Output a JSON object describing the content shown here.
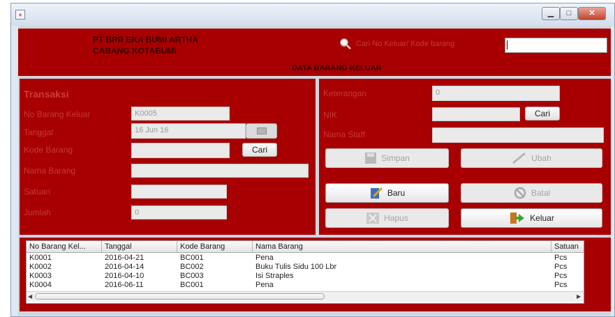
{
  "header": {
    "company_line1": "PT BPR EKA BUMI ARTHA",
    "company_line2": "CABANG KOTABUMI",
    "search_label": "Cari No Keluar/ Kode barang",
    "search_value": "",
    "title": "DATA BARANG KELUAR"
  },
  "transaksi": {
    "heading": "Transaksi",
    "no_keluar_label": "No Barang Keluar",
    "no_keluar_value": "K0005",
    "tanggal_label": "Tanggal",
    "tanggal_value": "16 Jun 16",
    "kode_label": "Kode Barang",
    "kode_value": "",
    "cari_label": "Cari",
    "nama_label": "Nama Barang",
    "nama_value": "",
    "satuan_label": "Satuan",
    "satuan_value": "",
    "jumlah_label": "Jumlah",
    "jumlah_value": "0"
  },
  "right": {
    "keterangan_label": "Keterangan",
    "keterangan_value": "0",
    "nik_label": "NIK",
    "nik_value": "",
    "cari_label": "Cari",
    "nama_staff_label": "Nama Staff",
    "nama_staff_value": ""
  },
  "actions": {
    "simpan": "Simpan",
    "ubah": "Ubah",
    "baru": "Baru",
    "batal": "Batal",
    "hapus": "Hapus",
    "keluar": "Keluar"
  },
  "table": {
    "headers": [
      "No Barang Kel...",
      "Tanggal",
      "Kode Barang",
      "Nama Barang",
      "Satuan"
    ],
    "rows": [
      [
        "K0001",
        "2016-04-21",
        "BC001",
        "Pena",
        "Pcs"
      ],
      [
        "K0002",
        "2016-04-14",
        "BC002",
        "Buku Tulis Sidu 100 Lbr",
        "Pcs"
      ],
      [
        "K0003",
        "2016-04-10",
        "BC003",
        "Isi Straples",
        "Pcs"
      ],
      [
        "K0004",
        "2016-06-11",
        "BC001",
        "Pena",
        "Pcs"
      ]
    ]
  },
  "colors": {
    "panel": "#a80000",
    "frame": "#cfd6df",
    "label": "#c23a3a"
  }
}
